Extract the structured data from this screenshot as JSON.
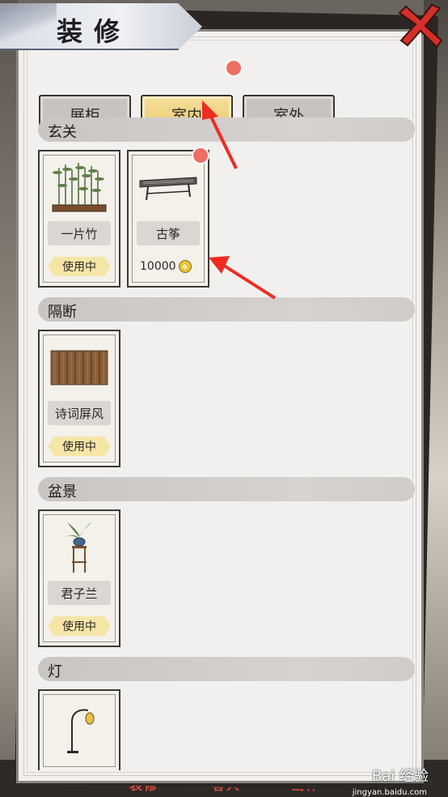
{
  "window": {
    "title": "装修"
  },
  "tabs": [
    {
      "label": "展柜",
      "active": false
    },
    {
      "label": "室内",
      "active": true,
      "has_notification": true
    },
    {
      "label": "室外",
      "active": false
    }
  ],
  "sections": [
    {
      "title": "玄关",
      "items": [
        {
          "name": "一片竹",
          "status": "使用中",
          "icon": "bamboo-icon"
        },
        {
          "name": "古筝",
          "price": "10000",
          "icon": "guzheng-icon",
          "has_notification": true
        }
      ]
    },
    {
      "title": "隔断",
      "items": [
        {
          "name": "诗词屏风",
          "status": "使用中",
          "icon": "folding-screen-icon"
        }
      ]
    },
    {
      "title": "盆景",
      "items": [
        {
          "name": "君子兰",
          "status": "使用中",
          "icon": "potted-orchid-icon"
        }
      ]
    },
    {
      "title": "灯",
      "items": [
        {
          "name": "",
          "icon": "lantern-lamp-icon"
        }
      ]
    }
  ],
  "bottom_nav": [
    "表修",
    "客人",
    "画作"
  ],
  "watermark": {
    "brand": "Bai 经验",
    "url": "jingyan.baidu.com"
  },
  "colors": {
    "accent_gold": "#e8c870",
    "notification_red": "#ee6f63",
    "close_red": "#d62f2a"
  }
}
